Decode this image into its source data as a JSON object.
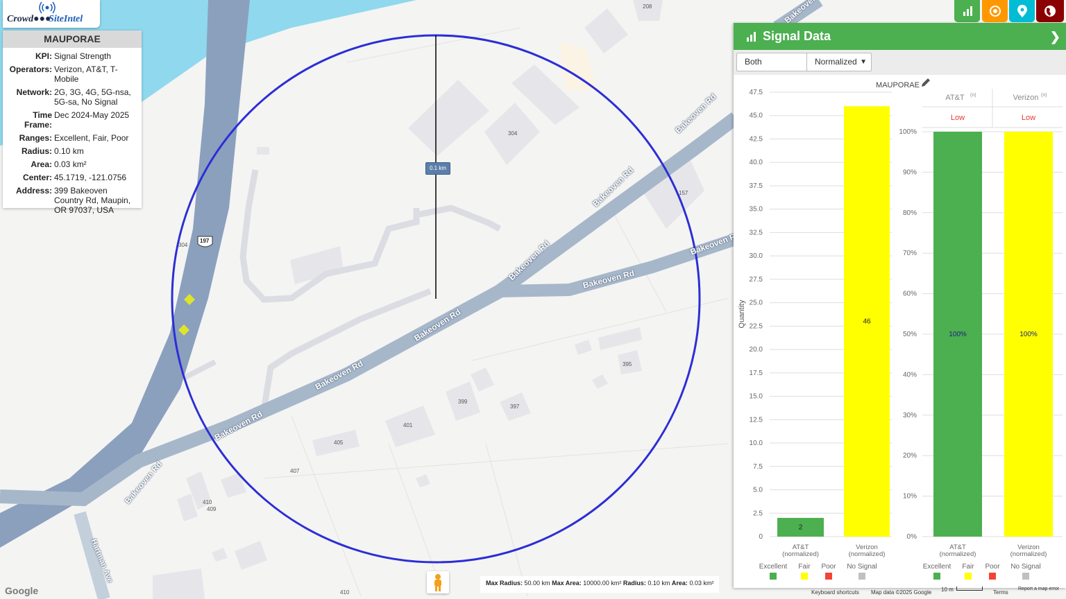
{
  "app": {
    "logo_text_1": "Crowd",
    "logo_text_2": "SiteIntel"
  },
  "info_panel": {
    "title": "MAUPORAE",
    "rows": [
      {
        "key": "KPI:",
        "value": "Signal Strength"
      },
      {
        "key": "Operators:",
        "value": "Verizon, AT&T, T-Mobile"
      },
      {
        "key": "Network:",
        "value": "2G, 3G, 4G, 5G-nsa, 5G-sa, No Signal"
      },
      {
        "key": "Time Frame:",
        "value": "Dec 2024-May 2025"
      },
      {
        "key": "Ranges:",
        "value": "Excellent, Fair, Poor"
      },
      {
        "key": "Radius:",
        "value": "0.10 km"
      },
      {
        "key": "Area:",
        "value": "0.03 km²"
      },
      {
        "key": "Center:",
        "value": "45.1719, -121.0756"
      },
      {
        "key": "Address:",
        "value": "399 Bakeoven Country Rd, Maupin, OR 97037, USA"
      }
    ]
  },
  "toolbar_buttons": [
    {
      "name": "chart-icon",
      "color": "#4caf50"
    },
    {
      "name": "target-icon",
      "color": "#ff9800"
    },
    {
      "name": "location-pin-icon",
      "color": "#00bcd4"
    },
    {
      "name": "globe-icon",
      "color": "#8b0000"
    }
  ],
  "map": {
    "roads": [
      "Bakeoven Rd",
      "Bakeoven Rd",
      "Bakeoven Rd",
      "Bakeoven Rd",
      "Bakeoven Rd",
      "Bakeoven Rd",
      "Bakeoven Rd",
      "Bakeoven Rd",
      "Bakeoven"
    ],
    "street_2": "Hartman Ave",
    "highway_shield": "197",
    "house_numbers": [
      "208",
      "304",
      "157",
      "304",
      "395",
      "399",
      "397",
      "401",
      "405",
      "407",
      "410",
      "409",
      "410"
    ],
    "radius_label": "0.1 km",
    "google_logo": "Google"
  },
  "signal_panel": {
    "title": "Signal Data",
    "select_1": "Both",
    "select_2": "Normalized",
    "colors": {
      "excellent": "#4caf50",
      "fair": "#ffff00",
      "poor": "#f44336",
      "no_signal": "#c0c0c0",
      "low_text": "#e53935"
    }
  },
  "chart_data": [
    {
      "type": "bar",
      "title": "MAUPORAE",
      "ylabel": "Quantity",
      "ylim": [
        0,
        47.5
      ],
      "yticks": [
        "0",
        "2.5",
        "5.0",
        "7.5",
        "10.0",
        "12.5",
        "15.0",
        "17.5",
        "20.0",
        "22.5",
        "25.0",
        "27.5",
        "30.0",
        "32.5",
        "35.0",
        "37.5",
        "40.0",
        "42.5",
        "45.0",
        "47.5"
      ],
      "categories": [
        "AT&T (normalized)",
        "Verizon (normalized)"
      ],
      "category_lines": [
        [
          "AT&T",
          "(normalized)"
        ],
        [
          "Verizon",
          "(normalized)"
        ]
      ],
      "values": [
        2,
        46
      ],
      "bar_colors": [
        "#4caf50",
        "#ffff00"
      ],
      "data_labels": [
        "2",
        "46"
      ]
    },
    {
      "type": "bar",
      "ylim": [
        0,
        100
      ],
      "yticks": [
        "0%",
        "10%",
        "20%",
        "30%",
        "40%",
        "50%",
        "60%",
        "70%",
        "80%",
        "90%",
        "100%"
      ],
      "columns": [
        {
          "header": "AT&T",
          "sup": "(n)",
          "status": "Low"
        },
        {
          "header": "Verizon",
          "sup": "(n)",
          "status": "Low"
        }
      ],
      "categories": [
        "AT&T (normalized)",
        "Verizon (normalized)"
      ],
      "category_lines": [
        [
          "AT&T",
          "(normalized)"
        ],
        [
          "Verizon",
          "(normalized)"
        ]
      ],
      "values": [
        100,
        100
      ],
      "bar_colors": [
        "#4caf50",
        "#ffff00"
      ],
      "data_labels": [
        "100%",
        "100%"
      ]
    }
  ],
  "legend": [
    {
      "label": "Excellent",
      "color": "#4caf50"
    },
    {
      "label": "Fair",
      "color": "#ffff00"
    },
    {
      "label": "Poor",
      "color": "#f44336"
    },
    {
      "label": "No Signal",
      "color": "#c0c0c0"
    }
  ],
  "bottom_bar": {
    "max_radius_label": "Max Radius:",
    "max_radius_value": "50.00 km",
    "max_area_label": "Max Area:",
    "max_area_value": "10000.00 km²",
    "radius_label": "Radius:",
    "radius_value": "0.10 km",
    "area_label": "Area:",
    "area_value": "0.03 km²"
  },
  "map_footer": {
    "shortcuts": "Keyboard shortcuts",
    "map_data": "Map data ©2025 Google",
    "scale": "10 m",
    "terms": "Terms",
    "report": "Report a map error"
  }
}
